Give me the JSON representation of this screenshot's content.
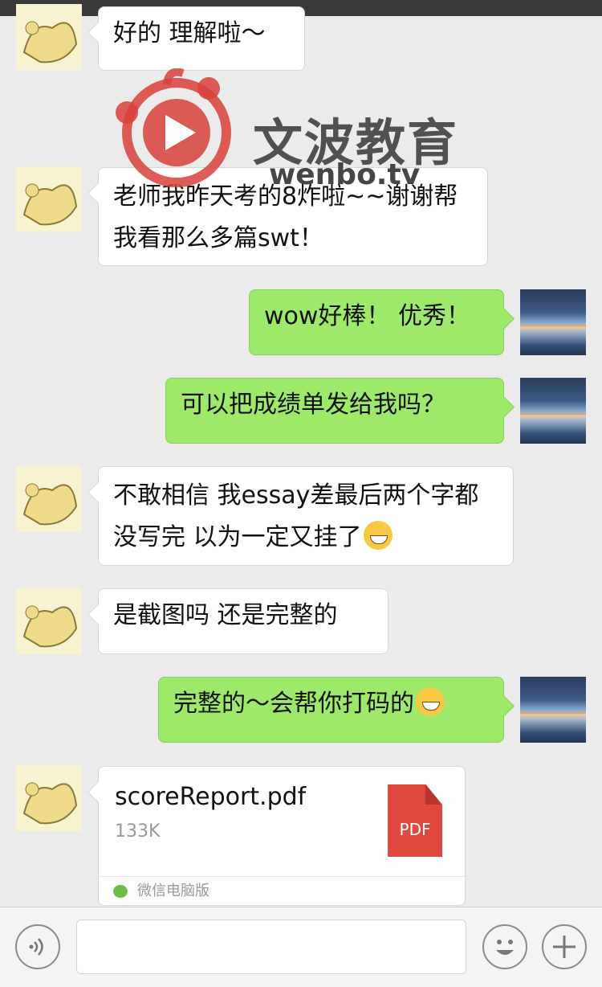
{
  "messages": [
    {
      "side": "left",
      "text": "好的 理解啦～"
    },
    {
      "side": "left",
      "text": "老师我昨天考的8炸啦~~谢谢帮我看那么多篇swt！"
    },
    {
      "side": "right",
      "text": "wow好棒！ 优秀！"
    },
    {
      "side": "right",
      "text": "可以把成绩单发给我吗？"
    },
    {
      "side": "left",
      "text": "不敢相信 我essay差最后两个字都没写完 以为一定又挂了"
    },
    {
      "side": "left",
      "text": "是截图吗 还是完整的"
    },
    {
      "side": "right",
      "text": "完整的～会帮你打码的"
    }
  ],
  "file_message": {
    "name": "scoreReport.pdf",
    "size": "133K",
    "icon_label": "PDF",
    "source": "微信电脑版"
  },
  "watermark": {
    "brand": "文波教育",
    "url": "wenbo.tv"
  },
  "input_bar": {
    "voice_icon": "voice-icon",
    "emoji_icon": "emoji-icon",
    "plus_icon": "plus-icon"
  }
}
